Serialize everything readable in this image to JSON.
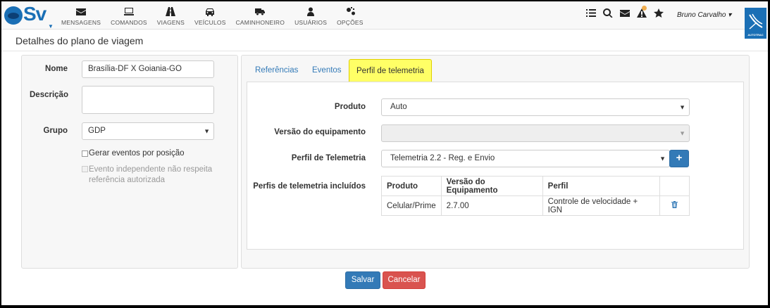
{
  "app": {
    "logo": "Sv"
  },
  "nav": {
    "items": [
      {
        "label": "MENSAGENS",
        "icon": "envelope-icon"
      },
      {
        "label": "COMANDOS",
        "icon": "monitor-icon"
      },
      {
        "label": "VIAGENS",
        "icon": "road-icon"
      },
      {
        "label": "VEÍCULOS",
        "icon": "car-icon"
      },
      {
        "label": "CAMINHONEIRO",
        "icon": "truck-icon"
      },
      {
        "label": "USUÁRIOS",
        "icon": "user-icon"
      },
      {
        "label": "OPÇÕES",
        "icon": "gears-icon"
      }
    ],
    "right_icons": [
      "list-icon",
      "search-icon",
      "envelope-icon",
      "alert-icon",
      "star-icon"
    ],
    "user_name": "Bruno Carvalho",
    "brand": "AUTOTRAC"
  },
  "page": {
    "title": "Detalhes do plano de viagem"
  },
  "form": {
    "nome_label": "Nome",
    "nome_value": "Brasília-DF X Goiania-GO",
    "descricao_label": "Descrição",
    "descricao_value": "",
    "grupo_label": "Grupo",
    "grupo_value": "GDP",
    "check_gerar": "Gerar eventos por posição",
    "check_independente": "Evento independente não respeita referência autorizada"
  },
  "tabs": [
    {
      "label": "Referências"
    },
    {
      "label": "Eventos"
    },
    {
      "label": "Perfil de telemetria"
    }
  ],
  "telemetria": {
    "produto_label": "Produto",
    "produto_value": "Auto",
    "versao_label": "Versão do equipamento",
    "versao_value": "",
    "perfil_label": "Perfil de Telemetria",
    "perfil_value": "Telemetria 2.2 - Reg. e Envio",
    "incluidos_label": "Perfis de telemetria incluídos",
    "table": {
      "headers": [
        "Produto",
        "Versão do Equipamento",
        "Perfil",
        ""
      ],
      "rows": [
        {
          "produto": "Celular/Prime",
          "versao": "2.7.00",
          "perfil": "Controle de velocidade + IGN"
        }
      ]
    }
  },
  "actions": {
    "save": "Salvar",
    "cancel": "Cancelar"
  }
}
